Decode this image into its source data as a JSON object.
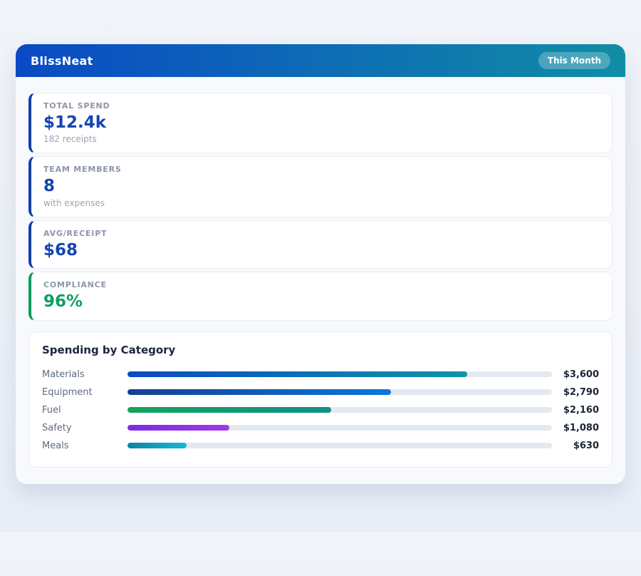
{
  "app": {
    "title": "BlissNeat",
    "period_badge": "This Month"
  },
  "colors": {
    "header_gradient_from": "#0a4ac5",
    "header_gradient_to": "#118da5",
    "stat_accent_blue": "#1346b5",
    "stat_accent_green": "#0f9d64"
  },
  "stats": [
    {
      "label": "TOTAL SPEND",
      "value": "$12.4k",
      "sub": "182 receipts",
      "accent": "#1346b5"
    },
    {
      "label": "TEAM MEMBERS",
      "value": "8",
      "sub": "with expenses",
      "accent": "#1346b5"
    },
    {
      "label": "AVG/RECEIPT",
      "value": "$68",
      "accent": "#1346b5"
    },
    {
      "label": "COMPLIANCE",
      "value": "96%",
      "accent": "#0f9d64"
    }
  ],
  "category_section": {
    "title": "Spending by Category",
    "rows": [
      {
        "label": "Materials",
        "value": "$3,600",
        "pct": 80,
        "color_from": "#0b4ac4",
        "color_to": "#0f94a8"
      },
      {
        "label": "Equipment",
        "value": "$2,790",
        "pct": 62,
        "color_from": "#143f93",
        "color_to": "#0b77dc"
      },
      {
        "label": "Fuel",
        "value": "$2,160",
        "pct": 48,
        "color_from": "#14a35c",
        "color_to": "#0d9186"
      },
      {
        "label": "Safety",
        "value": "$1,080",
        "pct": 24,
        "color_from": "#7b2de2",
        "color_to": "#9d39e8"
      },
      {
        "label": "Meals",
        "value": "$630",
        "pct": 14,
        "color_from": "#0c83a2",
        "color_to": "#14b9d9"
      }
    ]
  },
  "chart_data": {
    "type": "bar",
    "orientation": "horizontal",
    "title": "Spending by Category",
    "categories": [
      "Materials",
      "Equipment",
      "Fuel",
      "Safety",
      "Meals"
    ],
    "values": [
      3600,
      2790,
      2160,
      1080,
      630
    ],
    "value_labels": [
      "$3,600",
      "$2,790",
      "$2,160",
      "$1,080",
      "$630"
    ],
    "xlim": [
      0,
      4500
    ],
    "grid": false,
    "legend": false
  }
}
